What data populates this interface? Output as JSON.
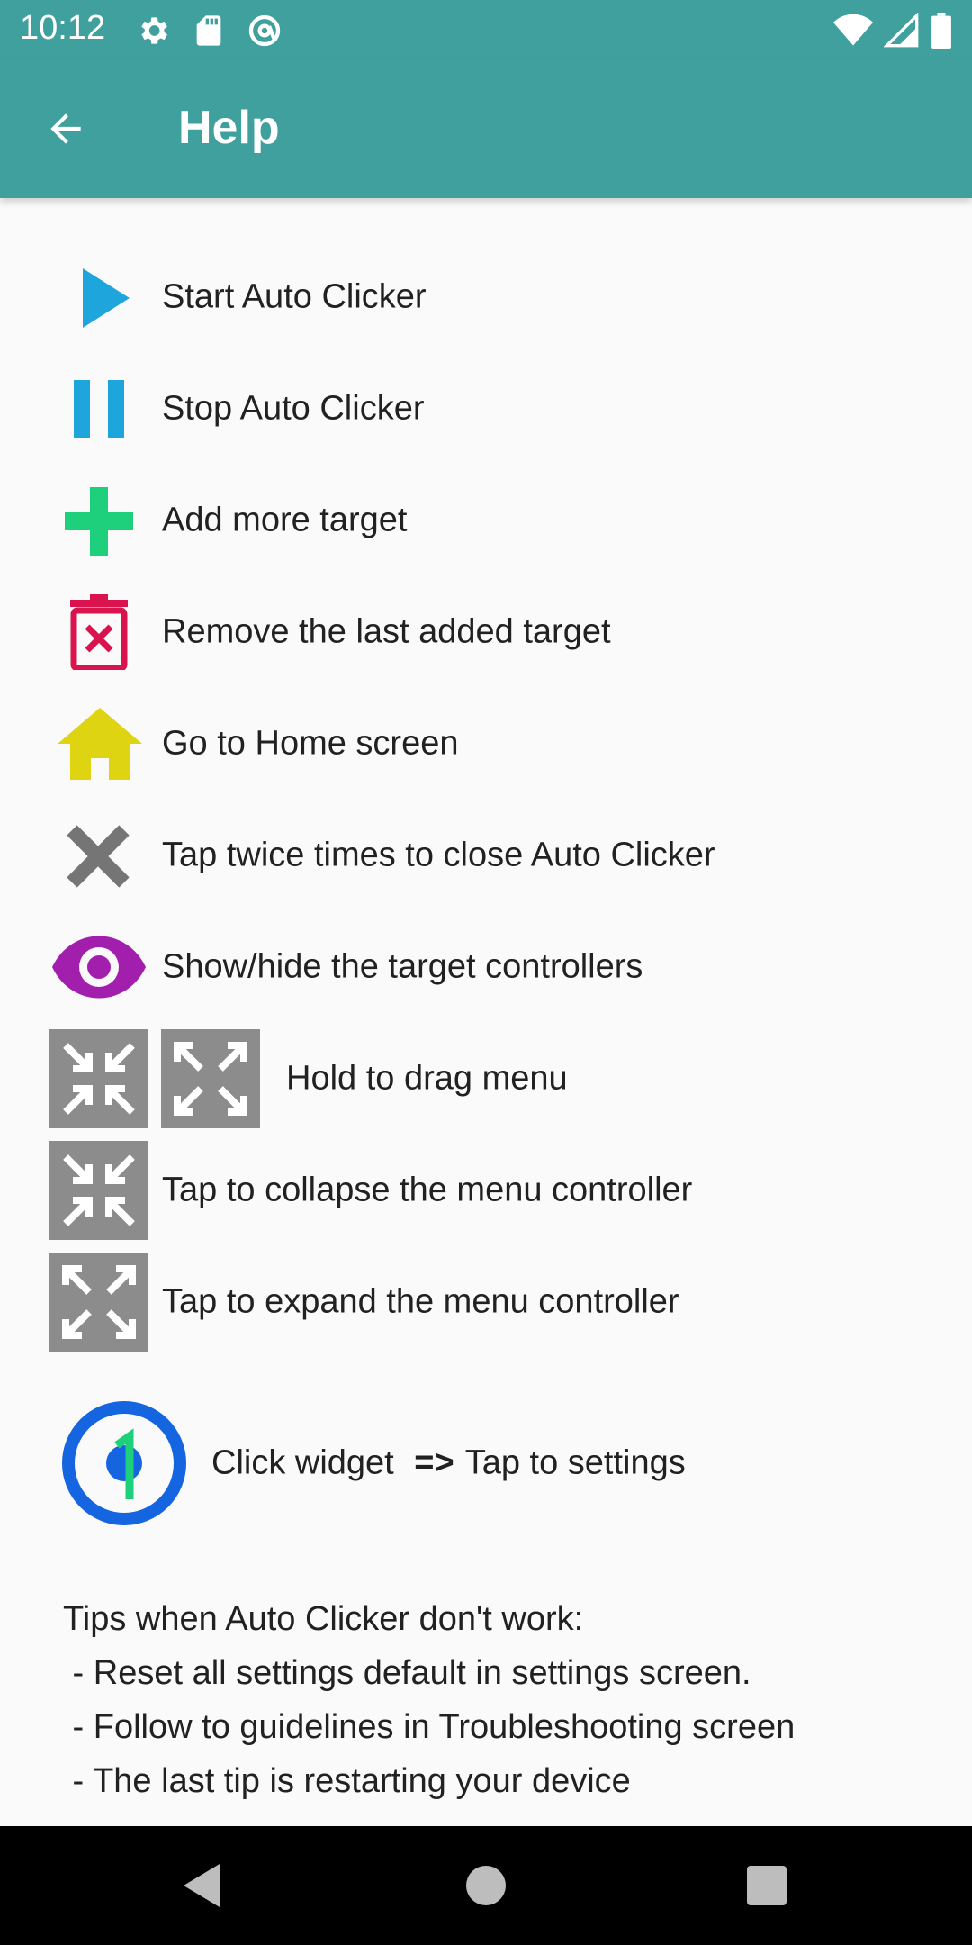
{
  "status_bar": {
    "time": "10:12"
  },
  "app_bar": {
    "title": "Help"
  },
  "items": [
    {
      "label": "Start Auto Clicker"
    },
    {
      "label": "Stop Auto Clicker"
    },
    {
      "label": "Add more target"
    },
    {
      "label": "Remove the last added target"
    },
    {
      "label": "Go to Home screen"
    },
    {
      "label": "Tap twice times to close Auto Clicker"
    },
    {
      "label": "Show/hide the target controllers"
    },
    {
      "label": "Hold to drag menu"
    },
    {
      "label": "Tap to collapse the menu controller"
    },
    {
      "label": "Tap to expand the menu controller"
    }
  ],
  "widget_row": {
    "label_before": "Click widget",
    "arrow": "=>",
    "label_after": "Tap to settings"
  },
  "tips": {
    "heading": "Tips when Auto Clicker don't work:",
    "lines": [
      " - Reset all settings default in settings screen.",
      " - Follow to guidelines in Troubleshooting screen",
      " - The last tip is restarting your device"
    ]
  },
  "colors": {
    "primary": "#40a09e",
    "play": "#1da5dc",
    "add": "#1ecf7c",
    "remove": "#d8134e",
    "home": "#dfd411",
    "close": "#757575",
    "eye": "#a21fae",
    "menu_tile": "#8c8c8c",
    "widget_ring": "#1565e0"
  }
}
